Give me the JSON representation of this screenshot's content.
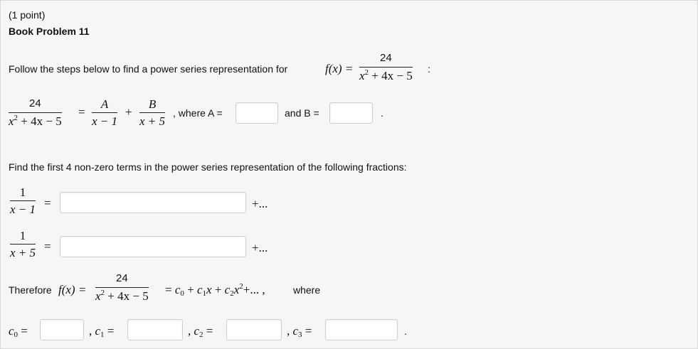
{
  "header": {
    "points": "(1 point)",
    "title": "Book Problem 11"
  },
  "intro": {
    "text": "Follow the steps below to find a power series representation for",
    "fx": "f(x) =",
    "trail": ":"
  },
  "fraction": {
    "numerator": "24",
    "x2": "x",
    "exp": "2",
    "rest": "+ 4x − 5"
  },
  "decomposition": {
    "eq": "=",
    "plus": "+",
    "A": "A",
    "B": "B",
    "den_A": "x − 1",
    "den_B": "x + 5",
    "where_A": ", where A =",
    "and_B": "and B =",
    "period": ".",
    "A_value": "",
    "B_value": ""
  },
  "instructions": "Find the first 4 non-zero terms in the power series representation of the following fractions:",
  "series": [
    {
      "one": "1",
      "den": "x − 1",
      "eq": "=",
      "value": "",
      "tail": "+..."
    },
    {
      "one": "1",
      "den": "x + 5",
      "eq": "=",
      "value": "",
      "tail": "+..."
    }
  ],
  "therefore": {
    "label": "Therefore",
    "fx": "f(x) =",
    "eq": "= ",
    "c": "c",
    "s0": "0",
    "s1": "1",
    "s2": "2",
    "plus1": " + ",
    "x1": "x",
    "plus2": " + ",
    "x2": "x",
    "exp": "2",
    "tail": "+... ,",
    "where": "where"
  },
  "coefficients": [
    {
      "c": "c",
      "sub": "0",
      "prefix": "",
      "eq": "=",
      "value": ""
    },
    {
      "c": "c",
      "sub": "1",
      "prefix": ",",
      "eq": "=",
      "value": ""
    },
    {
      "c": "c",
      "sub": "2",
      "prefix": ",",
      "eq": "=",
      "value": ""
    },
    {
      "c": "c",
      "sub": "3",
      "prefix": ",",
      "eq": "=",
      "value": ""
    }
  ],
  "end_period": "."
}
